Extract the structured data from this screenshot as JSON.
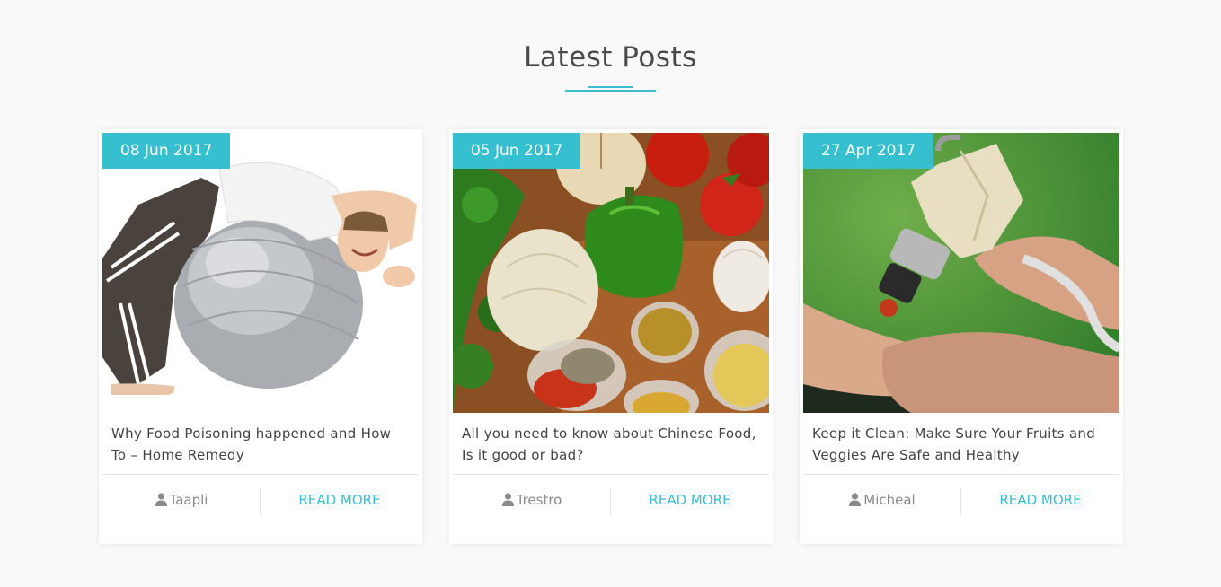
{
  "section": {
    "title": "Latest Posts"
  },
  "colors": {
    "accent": "#35bfcf",
    "title": "#4a4a4a",
    "text": "#444444",
    "muted": "#8a8a8a"
  },
  "posts": [
    {
      "date": "08 Jun 2017",
      "image": "exercise-ball-image",
      "title": "Why Food Poisoning happened and How To – Home Remedy",
      "author": "Taapli",
      "author_icon": "user-icon",
      "read_more": "READ MORE"
    },
    {
      "date": "05 Jun 2017",
      "image": "vegetables-spices-image",
      "title": "All you need to know about Chinese Food, Is it good or bad?",
      "author": "Trestro",
      "author_icon": "user-icon",
      "read_more": "READ MORE"
    },
    {
      "date": "27 Apr 2017",
      "image": "laser-therapy-image",
      "title": "Keep it Clean: Make Sure Your Fruits and Veggies Are Safe and Healthy",
      "author": "Micheal",
      "author_icon": "user-icon",
      "read_more": "READ MORE"
    }
  ]
}
